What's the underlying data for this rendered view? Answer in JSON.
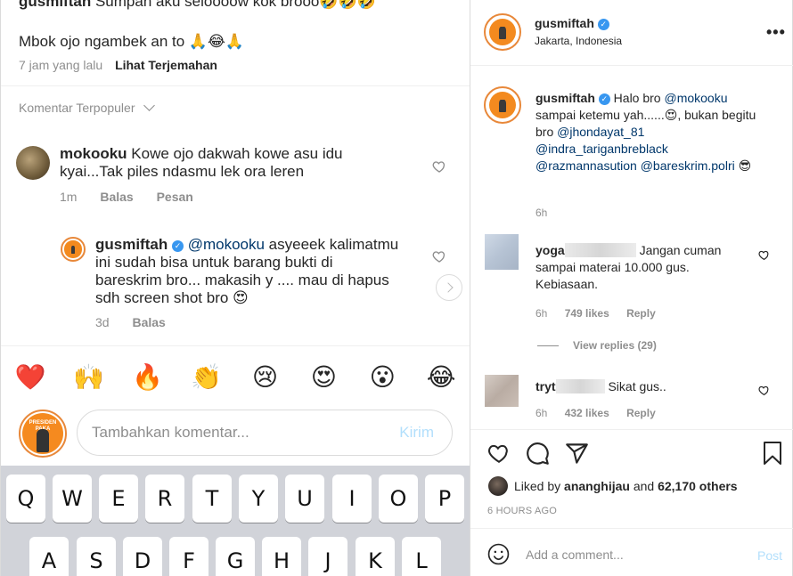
{
  "left": {
    "prev_comment": {
      "username": "gusmiftah",
      "line1": "Sumpah aku seloooow kok brooo🤣🤣🤣",
      "line2": "Mbok ojo ngambek an to 🙏😂🙏",
      "time": "7 jam yang lalu",
      "translate": "Lihat Terjemahan"
    },
    "sort_label": "Komentar Terpopuler",
    "comment1": {
      "username": "mokooku",
      "text_1": "Kowe ojo dakwah kowe asu idu",
      "text_2": "kyai...Tak piles ndasmu lek ora leren",
      "time": "1m",
      "reply": "Balas",
      "message": "Pesan"
    },
    "reply1": {
      "username": "gusmiftah",
      "mention": "@mokooku",
      "text_1": " asyeeek kalimatmu",
      "text_2": "ini sudah bisa untuk barang bukti di",
      "text_3": "bareskrim bro... makasih y .... mau di hapus",
      "text_4": "sdh screen shot bro 😍",
      "time": "3d",
      "reply": "Balas"
    },
    "emojis": [
      "❤️",
      "🙌",
      "🔥",
      "👏",
      "😢",
      "😍",
      "😮",
      "😂"
    ],
    "compose": {
      "placeholder": "Tambahkan komentar...",
      "send": "Kirim",
      "avatar_text": "PRESIDEN PAKA"
    },
    "keyboard": {
      "row1": [
        "Q",
        "W",
        "E",
        "R",
        "T",
        "Y",
        "U",
        "I",
        "O",
        "P"
      ],
      "row2": [
        "A",
        "S",
        "D",
        "F",
        "G",
        "H",
        "J",
        "K",
        "L"
      ]
    }
  },
  "right": {
    "header": {
      "username": "gusmiftah",
      "location": "Jakarta, Indonesia",
      "more": "•••"
    },
    "caption": {
      "username": "gusmiftah",
      "text_a": " Halo bro ",
      "mention1": "@mokooku",
      "text_b": " sampai ketemu yah......😍, bukan begitu bro ",
      "mention2": "@jhondayat_81",
      "mention3": "@indra_tariganbreblack",
      "mention4": "@razmannasution",
      "mention5": "@bareskrim.polri",
      "emoji": "😎",
      "time": "6h"
    },
    "comments": [
      {
        "username": "yoga",
        "text": "Jangan cuman sampai materai 10.000 gus. Kebiasaan.",
        "time": "6h",
        "likes": "749 likes",
        "reply": "Reply"
      },
      {
        "username": "tryt",
        "text": "Sikat gus..",
        "time": "6h",
        "likes": "432 likes",
        "reply": "Reply"
      }
    ],
    "view_replies": "View replies (29)",
    "liked_by": {
      "prefix": "Liked by ",
      "user": "ananghijau",
      "mid": " and ",
      "others": "62,170 others"
    },
    "date": "6 HOURS AGO",
    "add_comment_placeholder": "Add a comment...",
    "post": "Post"
  },
  "colors": {
    "verified": "#3897f0",
    "mention": "#00376b",
    "muted": "#8e8e8e",
    "send_disabled": "#b2dffc",
    "keyboard_bg": "#d1d3d9"
  }
}
